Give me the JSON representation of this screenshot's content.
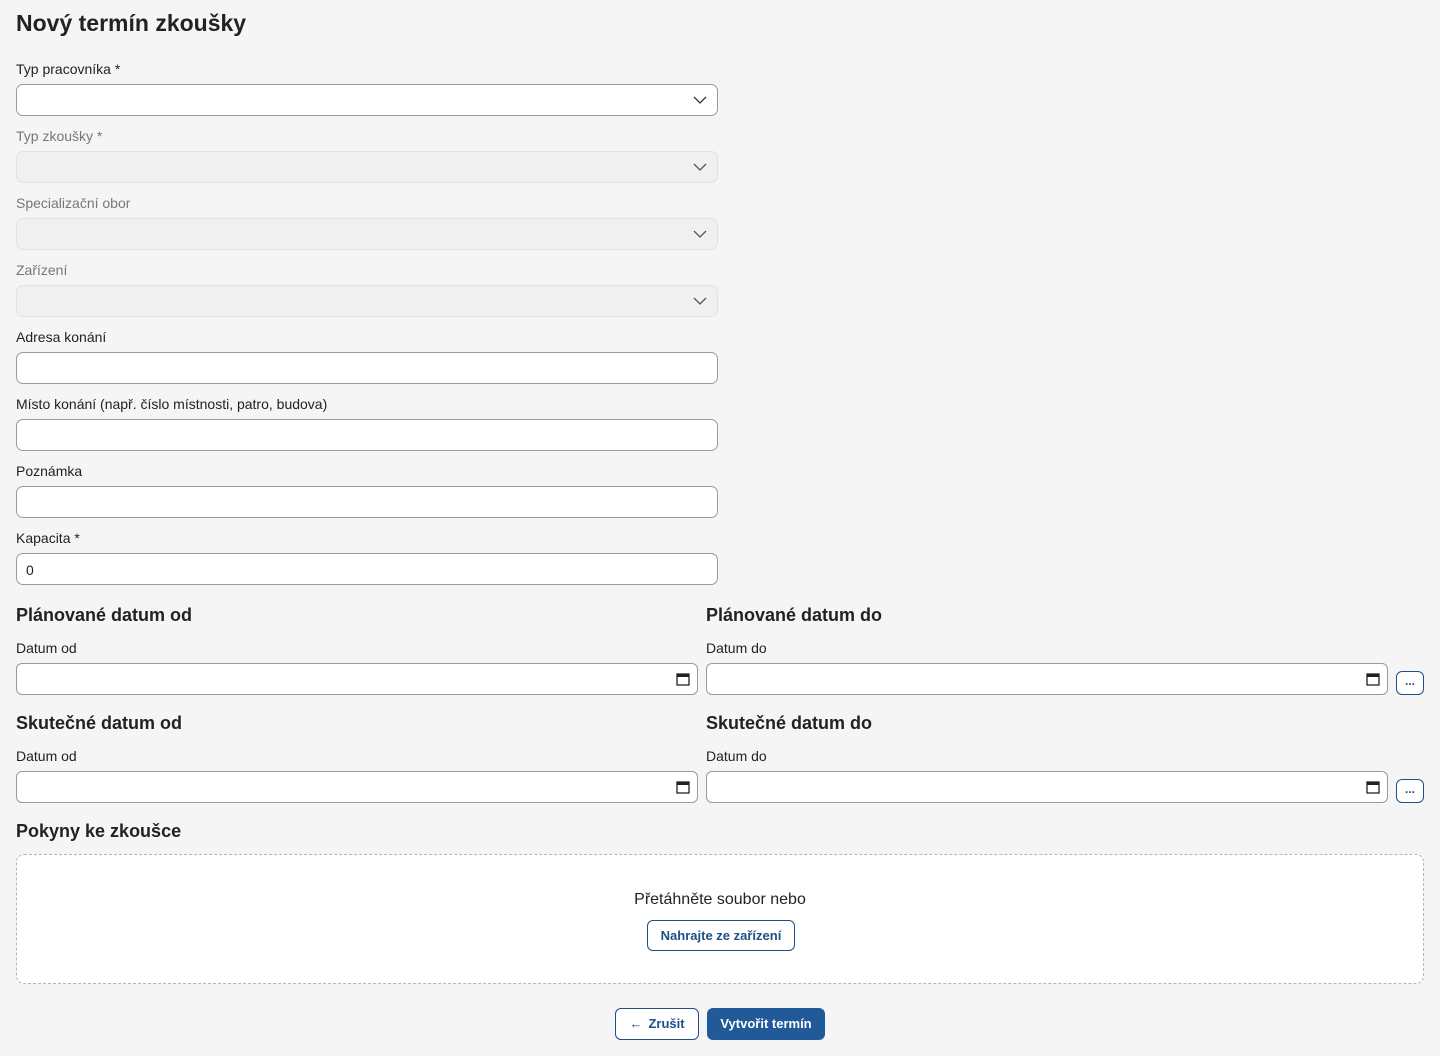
{
  "page": {
    "title": "Nový termín zkoušky"
  },
  "form": {
    "worker_type": {
      "label": "Typ pracovníka *",
      "value": ""
    },
    "exam_type": {
      "label": "Typ zkoušky *",
      "value": ""
    },
    "specialization": {
      "label": "Specializační obor",
      "value": ""
    },
    "facility": {
      "label": "Zařízení",
      "value": ""
    },
    "address": {
      "label": "Adresa konání",
      "value": ""
    },
    "place": {
      "label": "Místo konání (např. číslo místnosti, patro, budova)",
      "value": ""
    },
    "note": {
      "label": "Poznámka",
      "value": ""
    },
    "capacity": {
      "label": "Kapacita *",
      "value": "0"
    }
  },
  "dates": {
    "planned_from": {
      "heading": "Plánované datum od",
      "label": "Datum od"
    },
    "planned_to": {
      "heading": "Plánované datum do",
      "label": "Datum do"
    },
    "actual_from": {
      "heading": "Skutečné datum od",
      "label": "Datum od"
    },
    "actual_to": {
      "heading": "Skutečné datum do",
      "label": "Datum do"
    },
    "more_label": "..."
  },
  "instructions": {
    "heading": "Pokyny ke zkoušce",
    "drop_hint": "Přetáhněte soubor nebo",
    "upload_label": "Nahrajte ze zařízení"
  },
  "actions": {
    "cancel_arrow": "←",
    "cancel_label": "Zrušit",
    "create_label": "Vytvořit termín"
  },
  "icons": {
    "select": "chevron-down-icon",
    "date": "calendar-icon",
    "back": "arrow-left-icon"
  },
  "colors": {
    "accent": "#225a99",
    "background": "#f5f5f5",
    "border": "#9a9a9a"
  }
}
